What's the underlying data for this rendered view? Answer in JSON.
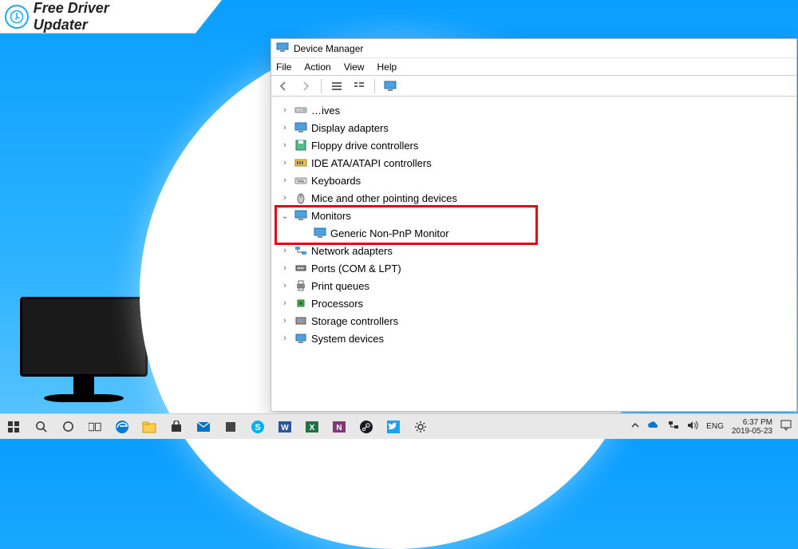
{
  "banner": {
    "title": "Free Driver Updater"
  },
  "window": {
    "title": "Device Manager",
    "menu": [
      "File",
      "Action",
      "View",
      "Help"
    ]
  },
  "tree": {
    "items": [
      {
        "label": "…ives",
        "expandable": true
      },
      {
        "label": "Display adapters",
        "expandable": true
      },
      {
        "label": "Floppy drive controllers",
        "expandable": true
      },
      {
        "label": "IDE ATA/ATAPI controllers",
        "expandable": true
      },
      {
        "label": "Keyboards",
        "expandable": true
      },
      {
        "label": "Mice and other pointing devices",
        "expandable": true
      },
      {
        "label": "Monitors",
        "expandable": true,
        "expanded": true,
        "children": [
          {
            "label": "Generic Non-PnP Monitor"
          }
        ]
      },
      {
        "label": "Network adapters",
        "expandable": true
      },
      {
        "label": "Ports (COM & LPT)",
        "expandable": true
      },
      {
        "label": "Print queues",
        "expandable": true
      },
      {
        "label": "Processors",
        "expandable": true
      },
      {
        "label": "Storage controllers",
        "expandable": true
      },
      {
        "label": "System devices",
        "expandable": true
      }
    ]
  },
  "taskbar": {
    "tray": {
      "lang": "ENG",
      "time": "6:37 PM",
      "date": "2019-05-23"
    }
  }
}
